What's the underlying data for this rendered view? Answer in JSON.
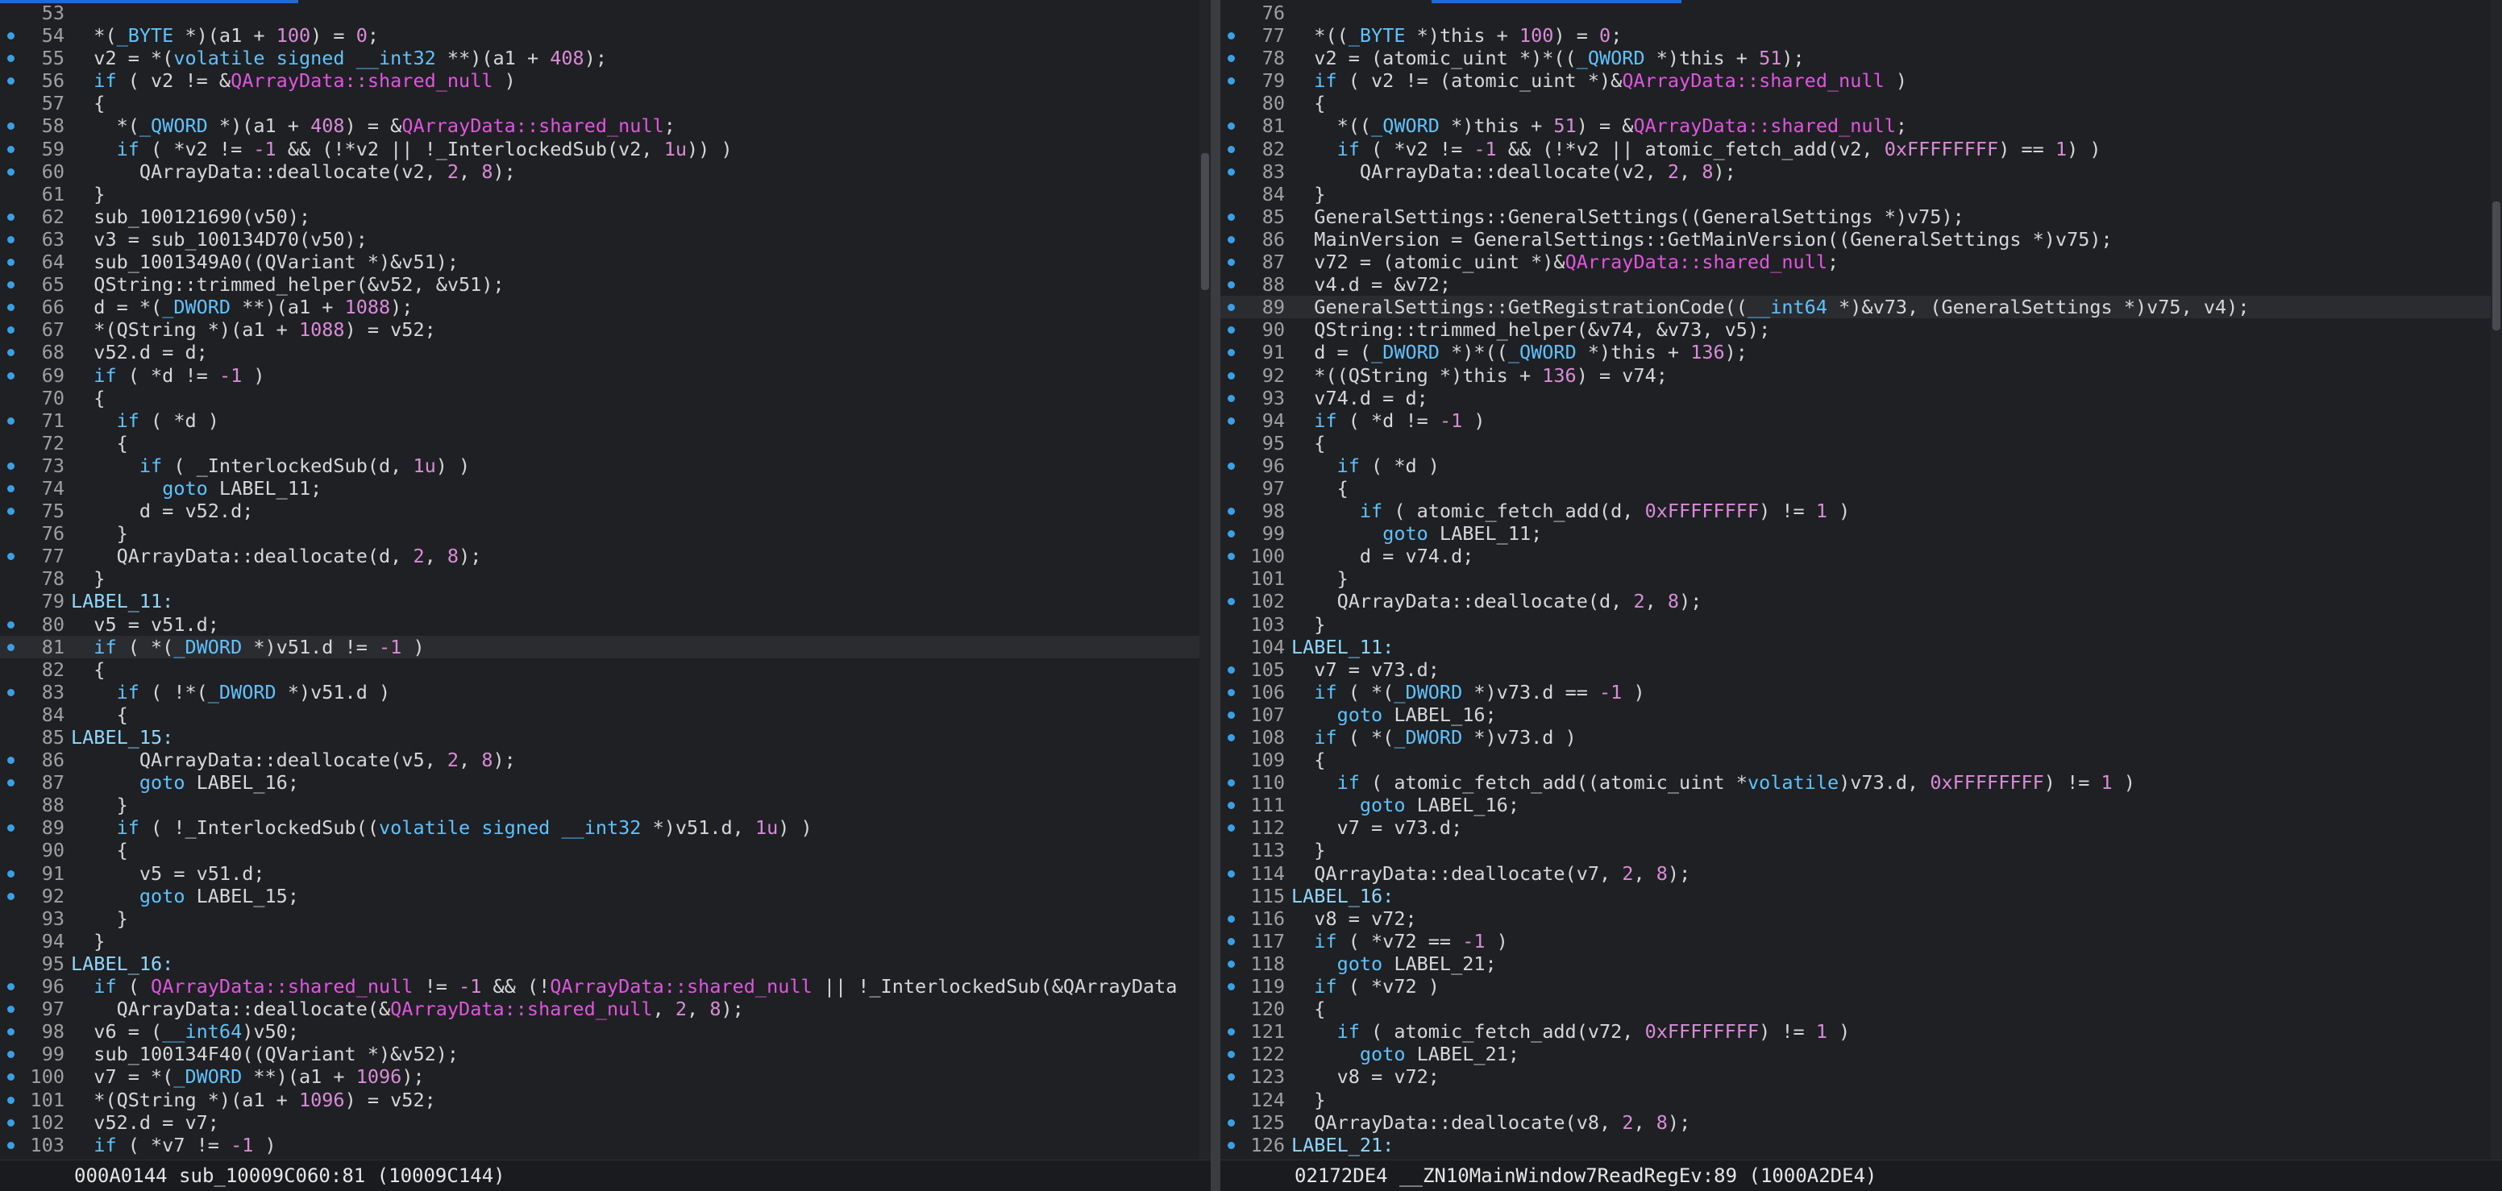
{
  "colors": {
    "background": "#1f2023",
    "keyword": "#5ec2ff",
    "number": "#d98bd9",
    "symbol": "#e055e0",
    "text": "#d7d7d7",
    "marker": "#3aa0e6"
  },
  "left": {
    "status": "000A0144 sub_10009C060:81 (10009C144)",
    "lines": [
      {
        "n": "53",
        "dot": false,
        "code": ""
      },
      {
        "n": "54",
        "dot": true,
        "code": "  *(_BYTE *)(a1 + 100) = 0;"
      },
      {
        "n": "55",
        "dot": true,
        "code": "  v2 = *(volatile signed __int32 **)(a1 + 408);"
      },
      {
        "n": "56",
        "dot": true,
        "code": "  if ( v2 != &QArrayData::shared_null )"
      },
      {
        "n": "57",
        "dot": false,
        "code": "  {"
      },
      {
        "n": "58",
        "dot": true,
        "code": "    *(_QWORD *)(a1 + 408) = &QArrayData::shared_null;"
      },
      {
        "n": "59",
        "dot": true,
        "code": "    if ( *v2 != -1 && (!*v2 || !_InterlockedSub(v2, 1u)) )"
      },
      {
        "n": "60",
        "dot": true,
        "code": "      QArrayData::deallocate(v2, 2, 8);"
      },
      {
        "n": "61",
        "dot": false,
        "code": "  }"
      },
      {
        "n": "62",
        "dot": true,
        "code": "  sub_100121690(v50);"
      },
      {
        "n": "63",
        "dot": true,
        "code": "  v3 = sub_100134D70(v50);"
      },
      {
        "n": "64",
        "dot": true,
        "code": "  sub_1001349A0((QVariant *)&v51);"
      },
      {
        "n": "65",
        "dot": true,
        "code": "  QString::trimmed_helper(&v52, &v51);"
      },
      {
        "n": "66",
        "dot": true,
        "code": "  d = *(_DWORD **)(a1 + 1088);"
      },
      {
        "n": "67",
        "dot": true,
        "code": "  *(QString *)(a1 + 1088) = v52;"
      },
      {
        "n": "68",
        "dot": true,
        "code": "  v52.d = d;"
      },
      {
        "n": "69",
        "dot": true,
        "code": "  if ( *d != -1 )"
      },
      {
        "n": "70",
        "dot": false,
        "code": "  {"
      },
      {
        "n": "71",
        "dot": true,
        "code": "    if ( *d )"
      },
      {
        "n": "72",
        "dot": false,
        "code": "    {"
      },
      {
        "n": "73",
        "dot": true,
        "code": "      if ( _InterlockedSub(d, 1u) )"
      },
      {
        "n": "74",
        "dot": true,
        "code": "        goto LABEL_11;"
      },
      {
        "n": "75",
        "dot": true,
        "code": "      d = v52.d;"
      },
      {
        "n": "76",
        "dot": false,
        "code": "    }"
      },
      {
        "n": "77",
        "dot": true,
        "code": "    QArrayData::deallocate(d, 2, 8);"
      },
      {
        "n": "78",
        "dot": false,
        "code": "  }"
      },
      {
        "n": "79",
        "dot": false,
        "code": "LABEL_11:"
      },
      {
        "n": "80",
        "dot": true,
        "code": "  v5 = v51.d;"
      },
      {
        "n": "81",
        "dot": true,
        "code": "  if ( *(_DWORD *)v51.d != -1 )",
        "current": true
      },
      {
        "n": "82",
        "dot": false,
        "code": "  {"
      },
      {
        "n": "83",
        "dot": true,
        "code": "    if ( !*(_DWORD *)v51.d )"
      },
      {
        "n": "84",
        "dot": false,
        "code": "    {"
      },
      {
        "n": "85",
        "dot": false,
        "code": "LABEL_15:"
      },
      {
        "n": "86",
        "dot": true,
        "code": "      QArrayData::deallocate(v5, 2, 8);"
      },
      {
        "n": "87",
        "dot": true,
        "code": "      goto LABEL_16;"
      },
      {
        "n": "88",
        "dot": false,
        "code": "    }"
      },
      {
        "n": "89",
        "dot": true,
        "code": "    if ( !_InterlockedSub((volatile signed __int32 *)v51.d, 1u) )"
      },
      {
        "n": "90",
        "dot": false,
        "code": "    {"
      },
      {
        "n": "91",
        "dot": true,
        "code": "      v5 = v51.d;"
      },
      {
        "n": "92",
        "dot": true,
        "code": "      goto LABEL_15;"
      },
      {
        "n": "93",
        "dot": false,
        "code": "    }"
      },
      {
        "n": "94",
        "dot": false,
        "code": "  }"
      },
      {
        "n": "95",
        "dot": false,
        "code": "LABEL_16:"
      },
      {
        "n": "96",
        "dot": true,
        "code": "  if ( QArrayData::shared_null != -1 && (!QArrayData::shared_null || !_InterlockedSub(&QArrayData"
      },
      {
        "n": "97",
        "dot": true,
        "code": "    QArrayData::deallocate(&QArrayData::shared_null, 2, 8);"
      },
      {
        "n": "98",
        "dot": true,
        "code": "  v6 = (__int64)v50;"
      },
      {
        "n": "99",
        "dot": true,
        "code": "  sub_100134F40((QVariant *)&v52);"
      },
      {
        "n": "100",
        "dot": true,
        "code": "  v7 = *(_DWORD **)(a1 + 1096);"
      },
      {
        "n": "101",
        "dot": true,
        "code": "  *(QString *)(a1 + 1096) = v52;"
      },
      {
        "n": "102",
        "dot": true,
        "code": "  v52.d = v7;"
      },
      {
        "n": "103",
        "dot": true,
        "code": "  if ( *v7 != -1 )"
      }
    ]
  },
  "right": {
    "status": "02172DE4 __ZN10MainWindow7ReadRegEv:89 (1000A2DE4)",
    "lines": [
      {
        "n": "76",
        "dot": false,
        "code": ""
      },
      {
        "n": "77",
        "dot": true,
        "code": "  *((_BYTE *)this + 100) = 0;"
      },
      {
        "n": "78",
        "dot": true,
        "code": "  v2 = (atomic_uint *)*((_QWORD *)this + 51);"
      },
      {
        "n": "79",
        "dot": true,
        "code": "  if ( v2 != (atomic_uint *)&QArrayData::shared_null )"
      },
      {
        "n": "80",
        "dot": false,
        "code": "  {"
      },
      {
        "n": "81",
        "dot": true,
        "code": "    *((_QWORD *)this + 51) = &QArrayData::shared_null;"
      },
      {
        "n": "82",
        "dot": true,
        "code": "    if ( *v2 != -1 && (!*v2 || atomic_fetch_add(v2, 0xFFFFFFFF) == 1) )"
      },
      {
        "n": "83",
        "dot": true,
        "code": "      QArrayData::deallocate(v2, 2, 8);"
      },
      {
        "n": "84",
        "dot": false,
        "code": "  }"
      },
      {
        "n": "85",
        "dot": true,
        "code": "  GeneralSettings::GeneralSettings((GeneralSettings *)v75);"
      },
      {
        "n": "86",
        "dot": true,
        "code": "  MainVersion = GeneralSettings::GetMainVersion((GeneralSettings *)v75);"
      },
      {
        "n": "87",
        "dot": true,
        "code": "  v72 = (atomic_uint *)&QArrayData::shared_null;"
      },
      {
        "n": "88",
        "dot": true,
        "code": "  v4.d = &v72;"
      },
      {
        "n": "89",
        "dot": true,
        "code": "  GeneralSettings::GetRegistrationCode((__int64 *)&v73, (GeneralSettings *)v75, v4);",
        "current": true
      },
      {
        "n": "90",
        "dot": true,
        "code": "  QString::trimmed_helper(&v74, &v73, v5);"
      },
      {
        "n": "91",
        "dot": true,
        "code": "  d = (_DWORD *)*((_QWORD *)this + 136);"
      },
      {
        "n": "92",
        "dot": true,
        "code": "  *((QString *)this + 136) = v74;"
      },
      {
        "n": "93",
        "dot": true,
        "code": "  v74.d = d;"
      },
      {
        "n": "94",
        "dot": true,
        "code": "  if ( *d != -1 )"
      },
      {
        "n": "95",
        "dot": false,
        "code": "  {"
      },
      {
        "n": "96",
        "dot": true,
        "code": "    if ( *d )"
      },
      {
        "n": "97",
        "dot": false,
        "code": "    {"
      },
      {
        "n": "98",
        "dot": true,
        "code": "      if ( atomic_fetch_add(d, 0xFFFFFFFF) != 1 )"
      },
      {
        "n": "99",
        "dot": true,
        "code": "        goto LABEL_11;"
      },
      {
        "n": "100",
        "dot": true,
        "code": "      d = v74.d;"
      },
      {
        "n": "101",
        "dot": false,
        "code": "    }"
      },
      {
        "n": "102",
        "dot": true,
        "code": "    QArrayData::deallocate(d, 2, 8);"
      },
      {
        "n": "103",
        "dot": false,
        "code": "  }"
      },
      {
        "n": "104",
        "dot": false,
        "code": "LABEL_11:"
      },
      {
        "n": "105",
        "dot": true,
        "code": "  v7 = v73.d;"
      },
      {
        "n": "106",
        "dot": true,
        "code": "  if ( *(_DWORD *)v73.d == -1 )"
      },
      {
        "n": "107",
        "dot": true,
        "code": "    goto LABEL_16;"
      },
      {
        "n": "108",
        "dot": true,
        "code": "  if ( *(_DWORD *)v73.d )"
      },
      {
        "n": "109",
        "dot": false,
        "code": "  {"
      },
      {
        "n": "110",
        "dot": true,
        "code": "    if ( atomic_fetch_add((atomic_uint *volatile)v73.d, 0xFFFFFFFF) != 1 )"
      },
      {
        "n": "111",
        "dot": true,
        "code": "      goto LABEL_16;"
      },
      {
        "n": "112",
        "dot": true,
        "code": "    v7 = v73.d;"
      },
      {
        "n": "113",
        "dot": false,
        "code": "  }"
      },
      {
        "n": "114",
        "dot": true,
        "code": "  QArrayData::deallocate(v7, 2, 8);"
      },
      {
        "n": "115",
        "dot": false,
        "code": "LABEL_16:"
      },
      {
        "n": "116",
        "dot": true,
        "code": "  v8 = v72;"
      },
      {
        "n": "117",
        "dot": true,
        "code": "  if ( *v72 == -1 )"
      },
      {
        "n": "118",
        "dot": true,
        "code": "    goto LABEL_21;"
      },
      {
        "n": "119",
        "dot": true,
        "code": "  if ( *v72 )"
      },
      {
        "n": "120",
        "dot": false,
        "code": "  {"
      },
      {
        "n": "121",
        "dot": true,
        "code": "    if ( atomic_fetch_add(v72, 0xFFFFFFFF) != 1 )"
      },
      {
        "n": "122",
        "dot": true,
        "code": "      goto LABEL_21;"
      },
      {
        "n": "123",
        "dot": true,
        "code": "    v8 = v72;"
      },
      {
        "n": "124",
        "dot": false,
        "code": "  }"
      },
      {
        "n": "125",
        "dot": true,
        "code": "  QArrayData::deallocate(v8, 2, 8);"
      },
      {
        "n": "126",
        "dot": true,
        "code": "LABEL_21:"
      }
    ]
  }
}
